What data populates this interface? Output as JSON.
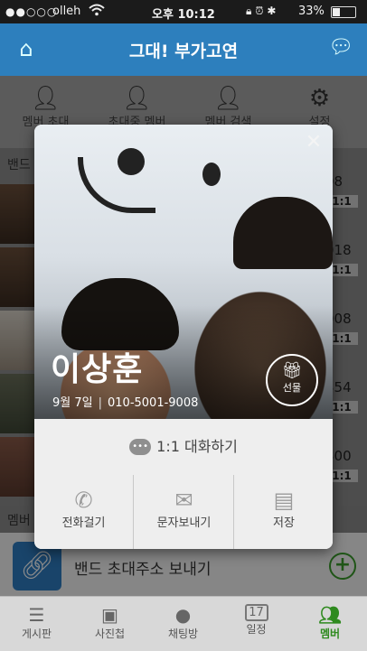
{
  "status_bar": {
    "signal": "●●○○○",
    "carrier": "olleh",
    "time": "오후 10:12",
    "battery": "33%"
  },
  "header": {
    "title": "그대! 부가고연"
  },
  "menu": [
    {
      "label": "멤버 초대",
      "icon": "add-user-icon"
    },
    {
      "label": "초대중 멤버",
      "icon": "pending-member-icon"
    },
    {
      "label": "멤버 검색",
      "icon": "search-member-icon"
    },
    {
      "label": "설정",
      "icon": "gear-icon"
    }
  ],
  "list": {
    "section_top": "밴드",
    "numbers": [
      "08",
      "1:1",
      "018",
      "1:1",
      "008",
      "1:1",
      "354",
      "1:1",
      "300",
      "1:1"
    ],
    "section_bottom": "멤버"
  },
  "invite": {
    "label": "밴드 초대주소 보내기"
  },
  "modal": {
    "name": "이상훈",
    "birthday": "9월 7일",
    "phone": "010-5001-9008",
    "gift_label": "선물",
    "chat_label": "1:1 대화하기",
    "chat_icon_text": "•••",
    "actions": [
      {
        "label": "전화걸기",
        "icon": "phone-icon"
      },
      {
        "label": "문자보내기",
        "icon": "envelope-icon"
      },
      {
        "label": "저장",
        "icon": "contact-card-icon"
      }
    ]
  },
  "tabbar": [
    {
      "label": "게시판",
      "icon": "board-icon"
    },
    {
      "label": "사진첩",
      "icon": "photo-album-icon"
    },
    {
      "label": "채팅방",
      "icon": "chat-room-icon"
    },
    {
      "label": "일정",
      "icon": "calendar-icon",
      "icon_text": "17"
    },
    {
      "label": "멤버",
      "icon": "members-icon",
      "active": true
    }
  ]
}
